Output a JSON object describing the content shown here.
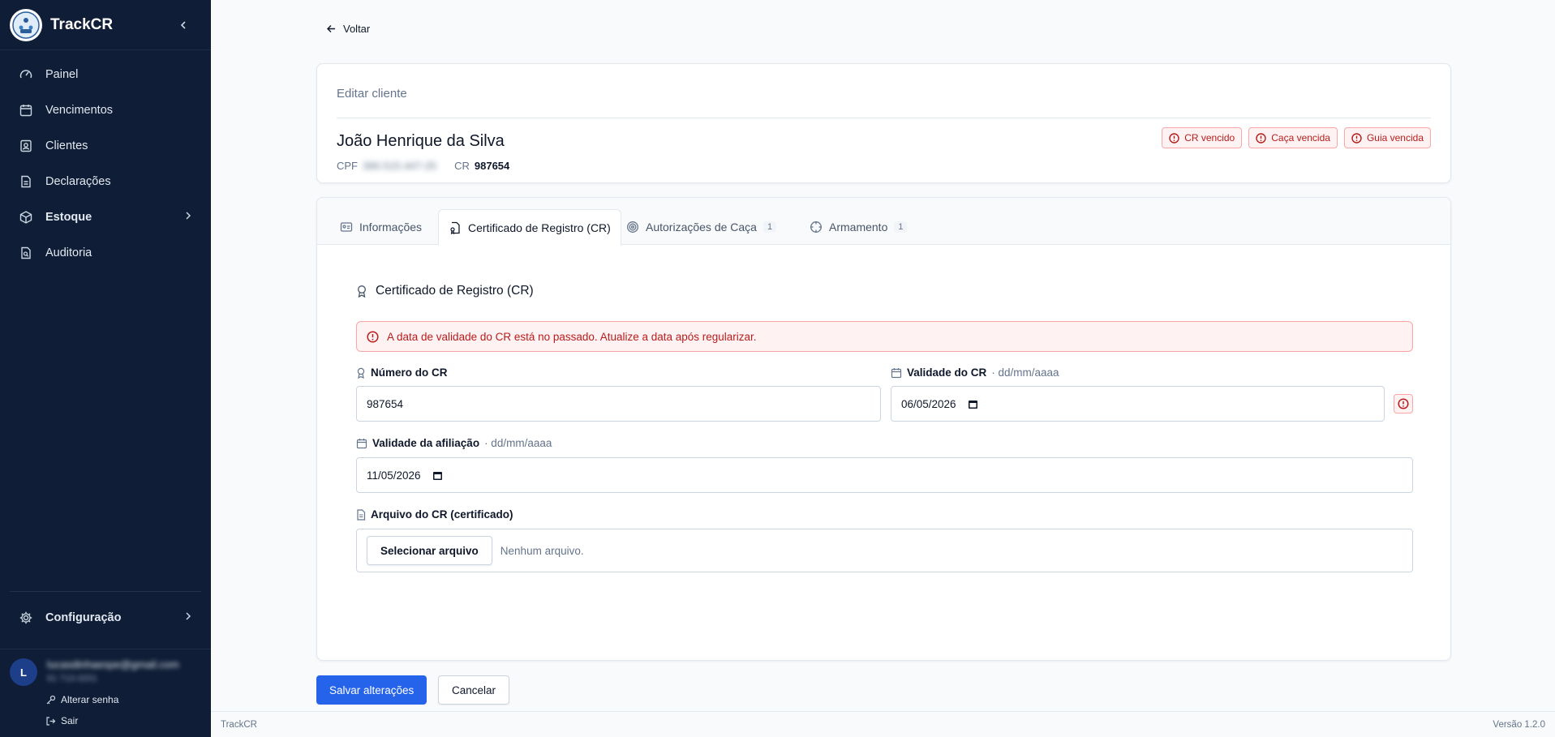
{
  "app": {
    "name": "TrackCR",
    "version_label": "Versão 1.2.0"
  },
  "sidebar": {
    "items": [
      {
        "label": "Painel",
        "icon": "gauge-icon"
      },
      {
        "label": "Vencimentos",
        "icon": "calendar-icon"
      },
      {
        "label": "Clientes",
        "icon": "contact-icon"
      },
      {
        "label": "Declarações",
        "icon": "document-icon"
      },
      {
        "label": "Estoque",
        "icon": "package-icon"
      },
      {
        "label": "Auditoria",
        "icon": "file-search-icon"
      }
    ],
    "config_label": "Configuração",
    "user": {
      "initial": "L",
      "email": "lucasdinhaespe@gmail.com",
      "phone": "61 713-3201",
      "change_password": "Alterar senha",
      "logout": "Sair"
    }
  },
  "page": {
    "back_label": "Voltar",
    "edit_label": "Editar cliente",
    "client": {
      "name": "João Henrique da Silva",
      "cpf_label": "CPF",
      "cpf_value": "390.515.447-25",
      "cr_label": "CR",
      "cr_value": "987654"
    },
    "badges": [
      "CR vencido",
      "Caça vencida",
      "Guia vencida"
    ],
    "tabs": [
      {
        "label": "Informações",
        "count": ""
      },
      {
        "label": "Certificado de Registro (CR)",
        "count": ""
      },
      {
        "label": "Autorizações de Caça",
        "count": "1"
      },
      {
        "label": "Armamento",
        "count": "1"
      }
    ],
    "section_title": "Certificado de Registro (CR)",
    "alert_text": "A data de validade do CR está no passado. Atualize a data após regularizar.",
    "fields": {
      "cr_number": {
        "label": "Número do CR",
        "value": "987654"
      },
      "cr_validity": {
        "label": "Validade do CR",
        "hint": "· dd/mm/aaaa",
        "value": "06/05/2026"
      },
      "affiliation_validity": {
        "label": "Validade da afiliação",
        "hint": "· dd/mm/aaaa",
        "value": "11/05/2026"
      },
      "cr_file": {
        "label": "Arquivo do CR (certificado)",
        "button": "Selecionar arquivo",
        "status": "Nenhum arquivo."
      }
    },
    "actions": {
      "save": "Salvar alterações",
      "cancel": "Cancelar"
    },
    "footer_left": "TrackCR"
  },
  "colors": {
    "sidebar_bg": "#0f1d36",
    "primary": "#2563eb",
    "danger": "#b91c1c",
    "danger_bg": "#fef2f2"
  }
}
